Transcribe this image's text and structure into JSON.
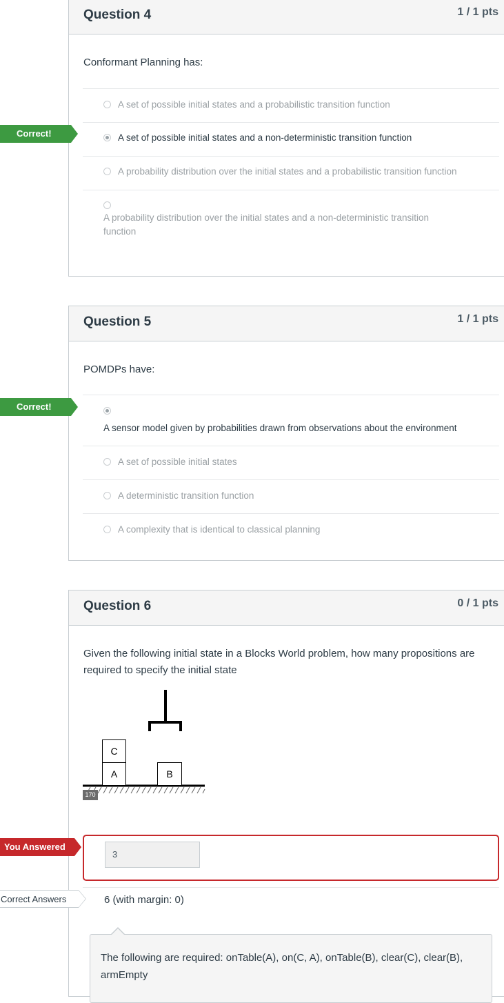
{
  "questions": {
    "q4": {
      "title": "Question 4",
      "points": "1 / 1 pts",
      "prompt": "Conformant Planning has:",
      "result_tag": "Correct!",
      "answers": [
        {
          "text": "A set of possible initial states and a probabilistic transition function",
          "selected": false
        },
        {
          "text": "A set of possible initial states and a non-deterministic transition function",
          "selected": true
        },
        {
          "text": "A probability distribution over the initial states and a probabilistic transition function",
          "selected": false
        },
        {
          "text_line1": "A probability distribution over the initial states and a non-deterministic transition",
          "text_line2": "function",
          "selected": false
        }
      ]
    },
    "q5": {
      "title": "Question 5",
      "points": "1 / 1 pts",
      "prompt": "POMDPs have:",
      "result_tag": "Correct!",
      "answers": [
        {
          "text": "A sensor model given by probabilities drawn from observations about the environment",
          "selected": true
        },
        {
          "text": "A set of possible initial states",
          "selected": false
        },
        {
          "text": "A deterministic transition function",
          "selected": false
        },
        {
          "text": "A complexity that is identical to classical planning",
          "selected": false
        }
      ]
    },
    "q6": {
      "title": "Question 6",
      "points": "0 / 1 pts",
      "prompt_line1": "Given the following initial state in a Blocks World problem, how many propositions are",
      "prompt_line2": "required to specify the initial state",
      "figure": {
        "block_c": "C",
        "block_a": "A",
        "block_b": "B",
        "badge": "170"
      },
      "you_answered_tag": "You Answered",
      "your_answer": "3",
      "correct_answers_tag": "Correct Answers",
      "correct_answer": "6 (with margin: 0)",
      "comment_line1": "The following are required: onTable(A), on(C, A), onTable(B), clear(C), clear(B),",
      "comment_line2": "armEmpty"
    }
  }
}
